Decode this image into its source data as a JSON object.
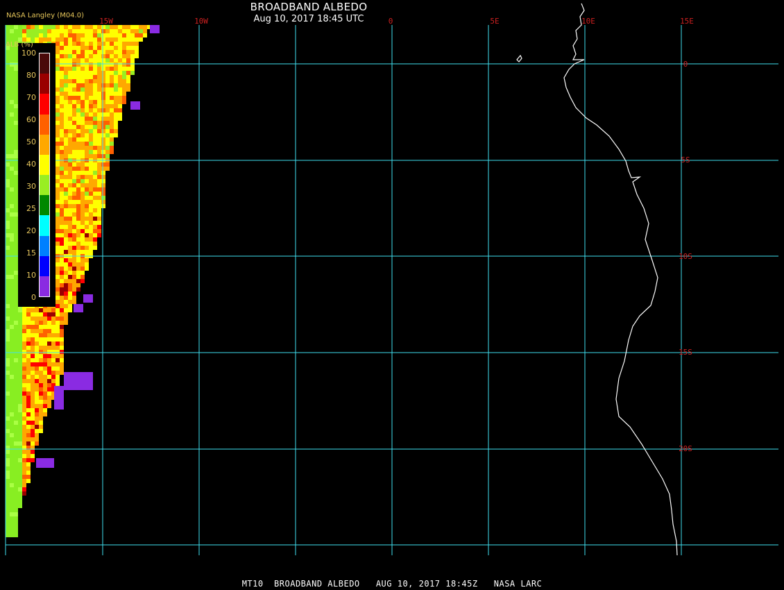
{
  "title": "BROADBAND ALBEDO",
  "datetime": "Aug 10, 2017 18:45 UTC",
  "credit": "NASA Langley (M04.0)",
  "footer": "MT10  BROADBAND ALBEDO   AUG 10, 2017 18:45Z   NASA LARC",
  "legend": {
    "title": "ALB (%)",
    "labels": [
      "100",
      "80",
      "70",
      "60",
      "50",
      "40",
      "30",
      "25",
      "20",
      "15",
      "10",
      "0"
    ],
    "colors": [
      "#4a0a0a",
      "#9a0000",
      "#ff0000",
      "#ff6000",
      "#ffa800",
      "#ffff00",
      "#99ee22",
      "#008800",
      "#00ffff",
      "#0080ff",
      "#0000ff",
      "#8a2be2"
    ]
  },
  "grid": {
    "longitudes": [
      "15W",
      "10W",
      "0",
      "5E",
      "10E",
      "15E"
    ],
    "latitudes": [
      "0",
      "5S",
      "10S",
      "15S",
      "20S"
    ],
    "line_color": "#40e0f0",
    "label_color": "#cc2020"
  },
  "coast_color": "#ffffff"
}
